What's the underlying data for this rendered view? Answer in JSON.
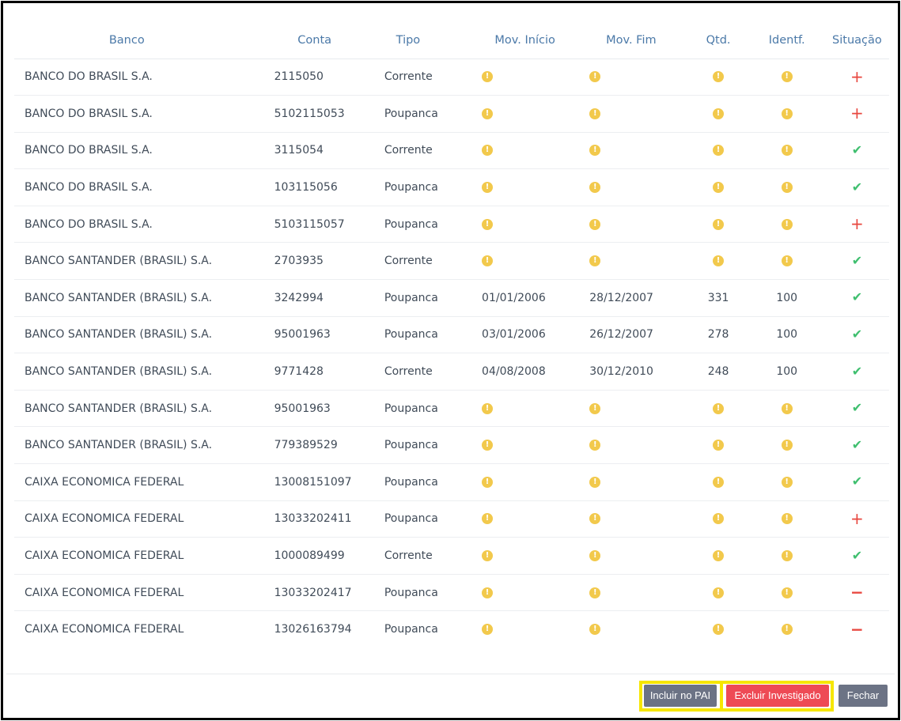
{
  "table": {
    "headers": {
      "banco": "Banco",
      "conta": "Conta",
      "tipo": "Tipo",
      "mov_inicio": "Mov. Início",
      "mov_fim": "Mov. Fim",
      "qtd": "Qtd.",
      "identf": "Identf.",
      "situacao": "Situação"
    },
    "rows": [
      {
        "banco": "BANCO DO BRASIL S.A.",
        "conta": "2115050",
        "tipo": "Corrente",
        "mov_inicio": null,
        "mov_fim": null,
        "qtd": null,
        "identf": null,
        "situacao": "plus"
      },
      {
        "banco": "BANCO DO BRASIL S.A.",
        "conta": "5102115053",
        "tipo": "Poupanca",
        "mov_inicio": null,
        "mov_fim": null,
        "qtd": null,
        "identf": null,
        "situacao": "plus"
      },
      {
        "banco": "BANCO DO BRASIL S.A.",
        "conta": "3115054",
        "tipo": "Corrente",
        "mov_inicio": null,
        "mov_fim": null,
        "qtd": null,
        "identf": null,
        "situacao": "check"
      },
      {
        "banco": "BANCO DO BRASIL S.A.",
        "conta": "103115056",
        "tipo": "Poupanca",
        "mov_inicio": null,
        "mov_fim": null,
        "qtd": null,
        "identf": null,
        "situacao": "check"
      },
      {
        "banco": "BANCO DO BRASIL S.A.",
        "conta": "5103115057",
        "tipo": "Poupanca",
        "mov_inicio": null,
        "mov_fim": null,
        "qtd": null,
        "identf": null,
        "situacao": "plus"
      },
      {
        "banco": "BANCO SANTANDER (BRASIL) S.A.",
        "conta": "2703935",
        "tipo": "Corrente",
        "mov_inicio": null,
        "mov_fim": null,
        "qtd": null,
        "identf": null,
        "situacao": "check"
      },
      {
        "banco": "BANCO SANTANDER (BRASIL) S.A.",
        "conta": "3242994",
        "tipo": "Poupanca",
        "mov_inicio": "01/01/2006",
        "mov_fim": "28/12/2007",
        "qtd": "331",
        "identf": "100",
        "situacao": "check"
      },
      {
        "banco": "BANCO SANTANDER (BRASIL) S.A.",
        "conta": "95001963",
        "tipo": "Poupanca",
        "mov_inicio": "03/01/2006",
        "mov_fim": "26/12/2007",
        "qtd": "278",
        "identf": "100",
        "situacao": "check"
      },
      {
        "banco": "BANCO SANTANDER (BRASIL) S.A.",
        "conta": "9771428",
        "tipo": "Corrente",
        "mov_inicio": "04/08/2008",
        "mov_fim": "30/12/2010",
        "qtd": "248",
        "identf": "100",
        "situacao": "check"
      },
      {
        "banco": "BANCO SANTANDER (BRASIL) S.A.",
        "conta": "95001963",
        "tipo": "Poupanca",
        "mov_inicio": null,
        "mov_fim": null,
        "qtd": null,
        "identf": null,
        "situacao": "check"
      },
      {
        "banco": "BANCO SANTANDER (BRASIL) S.A.",
        "conta": "779389529",
        "tipo": "Poupanca",
        "mov_inicio": null,
        "mov_fim": null,
        "qtd": null,
        "identf": null,
        "situacao": "check"
      },
      {
        "banco": "CAIXA ECONOMICA FEDERAL",
        "conta": "13008151097",
        "tipo": "Poupanca",
        "mov_inicio": null,
        "mov_fim": null,
        "qtd": null,
        "identf": null,
        "situacao": "check"
      },
      {
        "banco": "CAIXA ECONOMICA FEDERAL",
        "conta": "13033202411",
        "tipo": "Poupanca",
        "mov_inicio": null,
        "mov_fim": null,
        "qtd": null,
        "identf": null,
        "situacao": "plus"
      },
      {
        "banco": "CAIXA ECONOMICA FEDERAL",
        "conta": "1000089499",
        "tipo": "Corrente",
        "mov_inicio": null,
        "mov_fim": null,
        "qtd": null,
        "identf": null,
        "situacao": "check"
      },
      {
        "banco": "CAIXA ECONOMICA FEDERAL",
        "conta": "13033202417",
        "tipo": "Poupanca",
        "mov_inicio": null,
        "mov_fim": null,
        "qtd": null,
        "identf": null,
        "situacao": "minus"
      },
      {
        "banco": "CAIXA ECONOMICA FEDERAL",
        "conta": "13026163794",
        "tipo": "Poupanca",
        "mov_inicio": null,
        "mov_fim": null,
        "qtd": null,
        "identf": null,
        "situacao": "minus"
      }
    ]
  },
  "icons": {
    "missing_value": "warning-circle-icon",
    "situacao_plus": "plus-icon",
    "situacao_check": "check-icon",
    "situacao_minus": "minus-icon"
  },
  "footer": {
    "incluir_label": "Incluir no PAI",
    "excluir_label": "Excluir Investigado",
    "fechar_label": "Fechar"
  },
  "colors": {
    "header_text": "#4b79a8",
    "warning": "#f2c94c",
    "plus": "#e8473f",
    "check": "#3fbf6f",
    "button_gray": "#6c7385",
    "button_red": "#ee4a55",
    "highlight": "#f6e600"
  }
}
